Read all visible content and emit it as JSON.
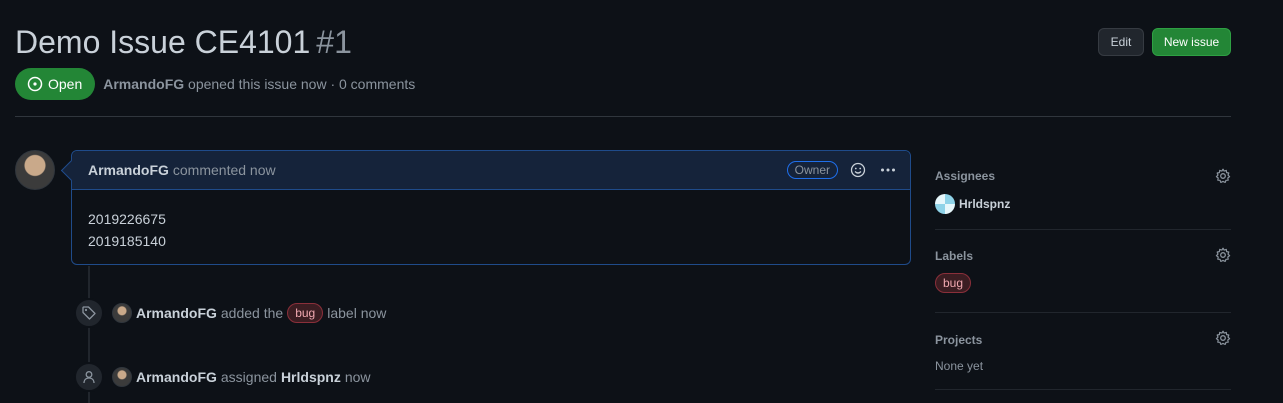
{
  "issue": {
    "title": "Demo Issue CE4101",
    "number": "#1",
    "state": "Open",
    "author": "ArmandoFG",
    "meta_suffix": "opened this issue now · 0 comments"
  },
  "actions": {
    "edit_label": "Edit",
    "new_issue_label": "New issue"
  },
  "comment": {
    "author": "ArmandoFG",
    "action": "commented now",
    "owner_badge": "Owner",
    "body_lines": [
      "2019226675",
      "2019185140"
    ]
  },
  "timeline": [
    {
      "icon": "tag-icon",
      "actor": "ArmandoFG",
      "pre": "added the",
      "label": "bug",
      "post": "label now"
    },
    {
      "icon": "person-icon",
      "actor": "ArmandoFG",
      "pre": "assigned",
      "target": "Hrldspnz",
      "post": "now"
    }
  ],
  "sidebar": {
    "assignees": {
      "heading": "Assignees",
      "items": [
        "Hrldspnz"
      ]
    },
    "labels": {
      "heading": "Labels",
      "items": [
        "bug"
      ]
    },
    "projects": {
      "heading": "Projects",
      "empty": "None yet"
    }
  },
  "colors": {
    "background": "#0d1117",
    "open_green": "#238636",
    "comment_border": "#1f4b8a",
    "bug_label": "#3b1d22"
  }
}
